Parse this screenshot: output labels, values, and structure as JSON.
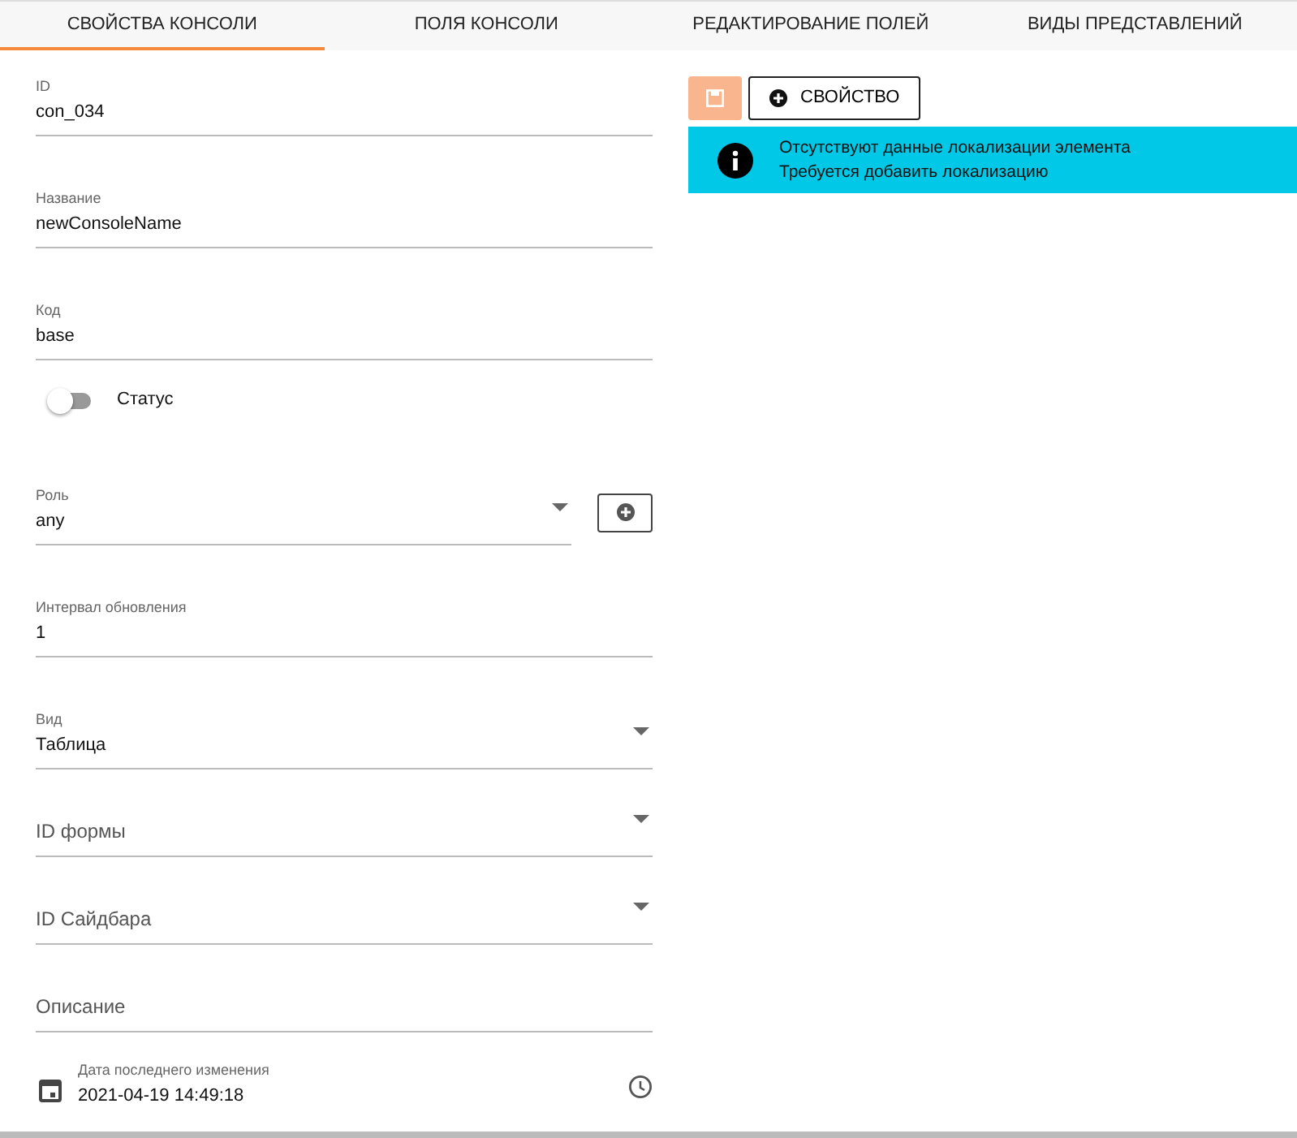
{
  "tabs": [
    {
      "label": "СВОЙСТВА КОНСОЛИ",
      "selected": true
    },
    {
      "label": "ПОЛЯ КОНСОЛИ",
      "selected": false
    },
    {
      "label": "РЕДАКТИРОВАНИЕ ПОЛЕЙ",
      "selected": false
    },
    {
      "label": "ВИДЫ ПРЕДСТАВЛЕНИЙ",
      "selected": false
    }
  ],
  "fields": [
    {
      "kind": "text",
      "label": "ID",
      "value": "con_034"
    },
    {
      "kind": "text",
      "label": "Название",
      "value": "newConsoleName"
    },
    {
      "kind": "text",
      "label": "Код",
      "value": "base"
    },
    {
      "kind": "toggle",
      "label": "Статус",
      "on": false
    },
    {
      "kind": "select",
      "label": "Роль",
      "value": "any",
      "add_button": true
    },
    {
      "kind": "text",
      "label": "Интервал обновления",
      "value": "1"
    },
    {
      "kind": "select",
      "label": "Вид",
      "value": "Таблица"
    },
    {
      "kind": "select",
      "placeholder": "ID формы"
    },
    {
      "kind": "select",
      "placeholder": "ID Сайдбара"
    },
    {
      "kind": "text",
      "placeholder": "Описание"
    },
    {
      "kind": "datetime",
      "label": "Дата последнего изменения",
      "value": "2021-04-19 14:49:18"
    }
  ],
  "toolbar": {
    "save_disabled": true,
    "add_property": "СВОЙСТВО"
  },
  "alert": {
    "lines": [
      "Отсутствуют данные локализации элемента",
      "Требуется добавить локализацию"
    ]
  }
}
